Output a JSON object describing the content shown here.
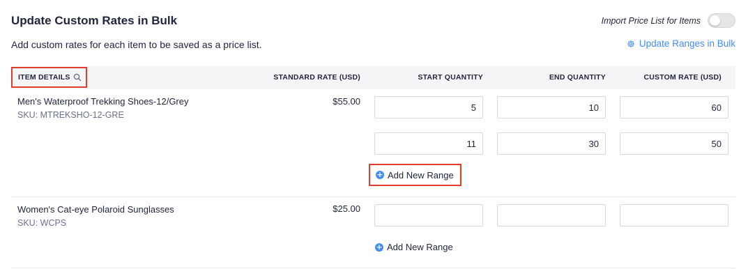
{
  "page": {
    "title": "Update Custom Rates in Bulk",
    "subtitle": "Add custom rates for each item to be saved as a price list.",
    "import_label": "Import Price List for Items",
    "import_toggle_on": false,
    "bulk_link": "Update Ranges in Bulk"
  },
  "table": {
    "headers": {
      "item": "ITEM DETAILS",
      "rate": "STANDARD RATE (USD)",
      "start": "START QUANTITY",
      "end": "END QUANTITY",
      "custom": "CUSTOM RATE (USD)"
    },
    "items": [
      {
        "name": "Men's Waterproof Trekking Shoes-12/Grey",
        "sku": "SKU: MTREKSHO-12-GRE",
        "rate": "$55.00",
        "ranges": [
          {
            "start": "5",
            "end": "10",
            "custom": "60"
          },
          {
            "start": "11",
            "end": "30",
            "custom": "50"
          }
        ],
        "add_label": "Add New Range"
      },
      {
        "name": "Women's Cat-eye Polaroid Sunglasses",
        "sku": "SKU: WCPS",
        "rate": "$25.00",
        "ranges": [
          {
            "start": "",
            "end": "",
            "custom": ""
          }
        ],
        "add_label": "Add New Range"
      }
    ]
  },
  "colors": {
    "accent": "#408dfb",
    "highlight": "#e23c2a",
    "header_bg": "#f5f5f7"
  }
}
